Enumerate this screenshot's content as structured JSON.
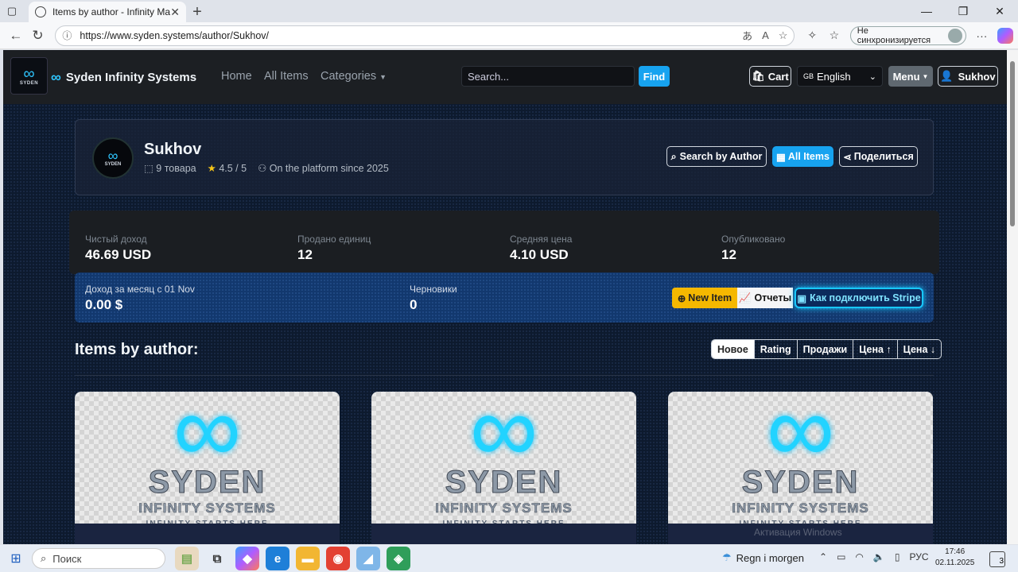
{
  "browser": {
    "tab_title": "Items by author - Infinity Market",
    "url": "https://www.syden.systems/author/Sukhov/",
    "sync_label": "Не синхронизируется"
  },
  "nav": {
    "logo_text": "SYDEN",
    "brand": "Syden Infinity Systems",
    "links": [
      "Home",
      "All Items",
      "Categories"
    ],
    "search_placeholder": "Search...",
    "find": "Find",
    "cart": "Cart",
    "language": "English",
    "language_flag": "GB",
    "menu": "Menu",
    "user": "Sukhov"
  },
  "author": {
    "name": "Sukhov",
    "items": "9 товара",
    "rating": "4.5 / 5",
    "since": "On the platform since 2025",
    "buttons": [
      "Search by Author",
      "All Items",
      "Поделиться"
    ]
  },
  "stats": [
    {
      "label": "Чистый доход",
      "value": "46.69 USD"
    },
    {
      "label": "Продано единиц",
      "value": "12"
    },
    {
      "label": "Средняя цена",
      "value": "4.10 USD"
    },
    {
      "label": "Опубликовано",
      "value": "12"
    }
  ],
  "month": {
    "income_label": "Доход за месяц с 01 Nov",
    "income_value": "0.00 $",
    "drafts_label": "Черновики",
    "drafts_value": "0",
    "new_item": "New Item",
    "reports": "Отчеты",
    "stripe": "Как подключить Stripe"
  },
  "items": {
    "title": "Items by author:",
    "sorts": [
      "Новое",
      "Rating",
      "Продажи",
      "Цена ↑",
      "Цена ↓"
    ],
    "active_sort": "Новое",
    "card_logo": {
      "word": "SYDEN",
      "sub": "INFINITY SYSTEMS",
      "tag": "INFINITY STARTS HERE"
    }
  },
  "watermark": "Активация Windows",
  "taskbar": {
    "search": "Поиск",
    "weather": "Regn i morgen",
    "lang": "РУС",
    "time": "17:46",
    "date": "02.11.2025",
    "notifications": "3"
  },
  "colors": {
    "accent": "#17a3f0",
    "new_item": "#f5b800",
    "stripe_glow": "#18c8ff",
    "page_bg": "#0d1a2e"
  }
}
